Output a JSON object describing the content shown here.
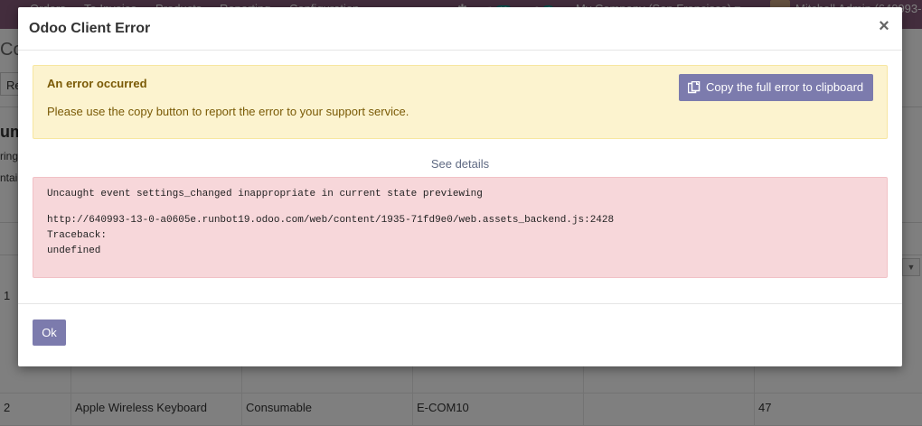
{
  "background": {
    "navbar": {
      "items": [
        "Orders",
        "To Invoice",
        "Products",
        "Reporting",
        "Configuration"
      ],
      "badge_activities": "18",
      "badge_messages": "4",
      "company": "My Company (San Francisco)",
      "user": "Mitchell Admin (640993-"
    },
    "breadcrumb": "Comp",
    "button_label": "Re",
    "side_title": "um",
    "side_line_1": "ring",
    "side_line_2": "ntain",
    "rows": [
      {
        "index": "1",
        "name": "",
        "type": "",
        "ref": "",
        "blank": "",
        "qty": ""
      },
      {
        "index": "2",
        "name": "Apple Wireless Keyboard",
        "type": "Consumable",
        "ref": "E-COM10",
        "blank": "",
        "qty": "47"
      }
    ]
  },
  "modal": {
    "title": "Odoo Client Error",
    "close_symbol": "×",
    "alert_title": "An error occurred",
    "alert_text": "Please use the copy button to report the error to your support service.",
    "copy_button": "Copy the full error to clipboard",
    "see_details": "See details",
    "error_lines": [
      "Uncaught event settings_changed inappropriate in current state previewing",
      "",
      "http://640993-13-0-a0605e.runbot19.odoo.com/web/content/1935-71fd9e0/web.assets_backend.js:2428",
      "Traceback:",
      "undefined"
    ],
    "ok_button": "Ok"
  },
  "colors": {
    "navbar": "#875a7b",
    "primary_button": "#7c7bad",
    "warning_bg": "#fcf3cf",
    "warning_text": "#7a5a06",
    "danger_bg": "#f7d7da"
  }
}
